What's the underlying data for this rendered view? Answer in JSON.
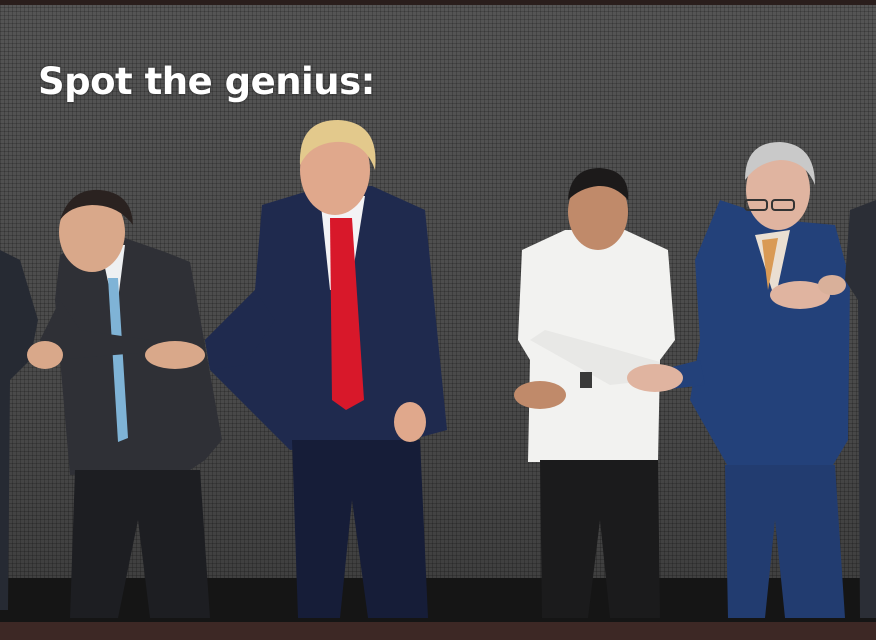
{
  "caption": "Spot the genius:",
  "colors": {
    "background": "#4a4a4a",
    "caption_text": "#ffffff",
    "dark_suit": "#2d2f36",
    "navy_suit": "#1f2a4e",
    "blue_suit": "#23417a",
    "white_shirt": "#f2f2f0",
    "red_tie": "#d8182a",
    "skin": "#d9a88a"
  }
}
